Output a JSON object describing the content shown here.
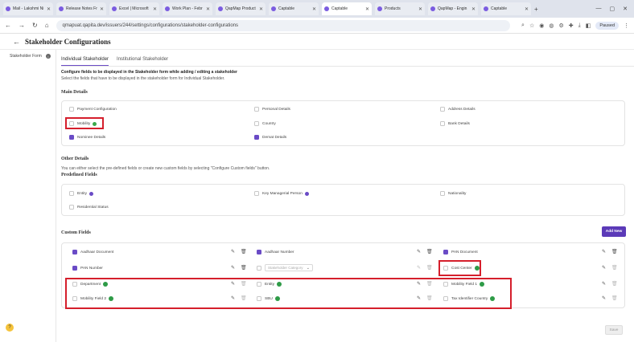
{
  "browser": {
    "tabs": [
      {
        "label": "Mail - Lakshmi Ni",
        "active": false
      },
      {
        "label": "Release Notes Fr",
        "active": false
      },
      {
        "label": "Excel | Microsoft",
        "active": false
      },
      {
        "label": "Work Plan - Febr",
        "active": false
      },
      {
        "label": "QapMap Product",
        "active": false
      },
      {
        "label": "Captable",
        "active": false
      },
      {
        "label": "Captable",
        "active": true
      },
      {
        "label": "Products",
        "active": false
      },
      {
        "label": "QapMap - Engin",
        "active": false
      },
      {
        "label": "Captable",
        "active": false
      }
    ],
    "url": "qmapuat.qapita.dev/issuers/244/settings/configurations/stakeholder-configurations",
    "profile_label": "Paused"
  },
  "header": {
    "title": "Stakeholder Configurations"
  },
  "sidebar": {
    "items": [
      {
        "label": "Stakeholder Form"
      }
    ]
  },
  "subtabs": [
    {
      "label": "Individual Stakeholder"
    },
    {
      "label": "Institutional Stakeholder"
    }
  ],
  "intro": {
    "line1": "Configure fields to be displayed in the Stakeholder form while adding / editing a stakeholder",
    "line2": "Select the fields that have to be displayed in the stakeholder form for Individual Stakeholder."
  },
  "main_details": {
    "title": "Main Details",
    "fields": [
      {
        "label": "Payment Configuration",
        "checked": false
      },
      {
        "label": "Personal Details",
        "checked": false
      },
      {
        "label": "Address Details",
        "checked": false
      },
      {
        "label": "Mobility",
        "checked": false
      },
      {
        "label": "Country",
        "checked": false
      },
      {
        "label": "Bank Details",
        "checked": false
      },
      {
        "label": "Nominee Details",
        "checked": true
      },
      {
        "label": "Demat Details",
        "checked": true
      }
    ]
  },
  "other_details": {
    "title": "Other Details",
    "desc": "You can either select the pre-defined fields or create new custom fields by selecting \"Configure Custom fields\" button.",
    "predefined_title": "Predefined Fields",
    "fields": [
      {
        "label": "Entity",
        "checked": false
      },
      {
        "label": "Key Managerial Person",
        "checked": false
      },
      {
        "label": "Nationality",
        "checked": false
      },
      {
        "label": "Residential Status",
        "checked": false
      }
    ]
  },
  "custom_fields": {
    "title": "Custom Fields",
    "add_label": "Add New",
    "select_placeholder": "Stakeholder Category",
    "fields": [
      {
        "label": "Aadhaar Document",
        "checked": true
      },
      {
        "label": "Aadhaar Number",
        "checked": true
      },
      {
        "label": "PAN Document",
        "checked": true
      },
      {
        "label": "PAN Number",
        "checked": true
      },
      {
        "label": "Cost Center",
        "checked": false
      },
      {
        "label": "Department",
        "checked": false
      },
      {
        "label": "Entity",
        "checked": false
      },
      {
        "label": "Mobility Field 1",
        "checked": false
      },
      {
        "label": "Mobility Field 2",
        "checked": false
      },
      {
        "label": "SBU",
        "checked": false
      },
      {
        "label": "Tax Identifier Country",
        "checked": false
      }
    ]
  },
  "footer": {
    "save_label": "Save"
  },
  "colors": {
    "accent": "#5b3ab8",
    "highlight": "#d51f2c",
    "badge_green": "#2e9b47"
  }
}
